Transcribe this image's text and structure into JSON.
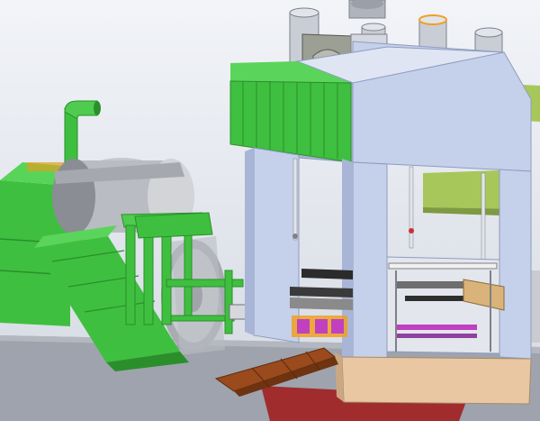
{
  "viewport": {
    "background_top": "#f2f4f8",
    "background_bottom": "#d4d9e2"
  },
  "colors": {
    "machine_green": "#3fbf3f",
    "machine_green_dark": "#2a8f2a",
    "press_frame_blue": "#c5d0ea",
    "press_frame_blue_dark": "#8f9cc0",
    "steel_grey": "#b9bcc2",
    "steel_grey_dark": "#7e8188",
    "base_tan": "#e8c7a2",
    "floor_grey": "#9ea3ad",
    "floor_red": "#a01818",
    "tray_brown": "#9a4a1c",
    "accent_orange": "#f0a020",
    "accent_magenta": "#c040c0",
    "guide_olive": "#a7c75a"
  }
}
